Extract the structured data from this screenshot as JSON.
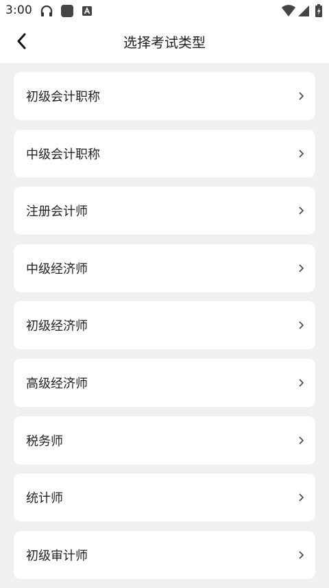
{
  "status_bar": {
    "time": "3:00",
    "icons": [
      "headphones-icon",
      "app-square-icon",
      "font-a-icon",
      "wifi-icon",
      "signal-icon",
      "battery-icon"
    ]
  },
  "header": {
    "title": "选择考试类型",
    "back_icon": "back-arrow-icon"
  },
  "exam_types": [
    {
      "label": "初级会计职称"
    },
    {
      "label": "中级会计职称"
    },
    {
      "label": "注册会计师"
    },
    {
      "label": "中级经济师"
    },
    {
      "label": "初级经济师"
    },
    {
      "label": "高级经济师"
    },
    {
      "label": "税务师"
    },
    {
      "label": "统计师"
    },
    {
      "label": "初级审计师"
    }
  ],
  "colors": {
    "background": "#f0f0f0",
    "card": "#ffffff",
    "text": "#222222",
    "chevron": "#444444"
  }
}
